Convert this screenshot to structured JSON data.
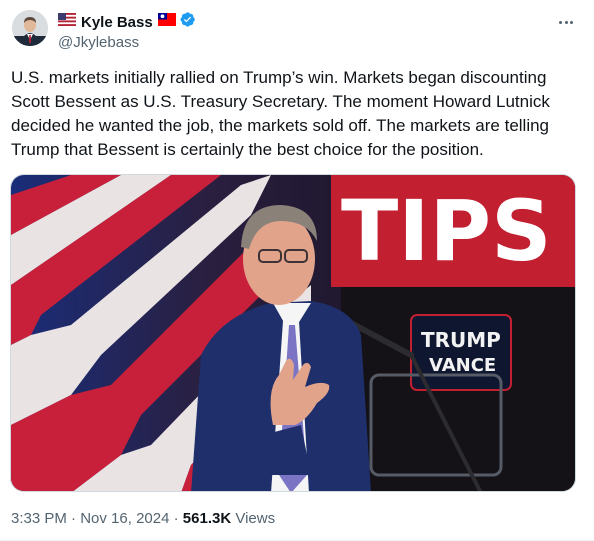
{
  "author": {
    "name": "Kyle Bass",
    "handle": "@Jkylebass",
    "verified": true
  },
  "icons": {
    "us_flag": "us-flag-icon",
    "taiwan_flag": "taiwan-flag-icon",
    "verified": "verified-badge-icon",
    "more": "more-options-icon"
  },
  "tweet": {
    "text": "U.S. markets initially rallied on Trump’s win. Markets began discounting\nScott Bessent as U.S. Treasury Secretary. The moment Howard Lutnick\ndecided he wanted the job, the markets sold off. The markets are telling\nTrump that Bessent is certainly the best choice for the position.",
    "image_sign_text": "TIPS",
    "image_placard_text": "TRUMP\nVANCE"
  },
  "meta": {
    "time": "3:33 PM",
    "date": "Nov 16, 2024",
    "views_count": "561.3K",
    "views_label": "Views"
  },
  "colors": {
    "text_primary": "#0f1419",
    "text_secondary": "#536471",
    "verified_blue": "#1d9bf0",
    "border": "#cfd9de"
  }
}
